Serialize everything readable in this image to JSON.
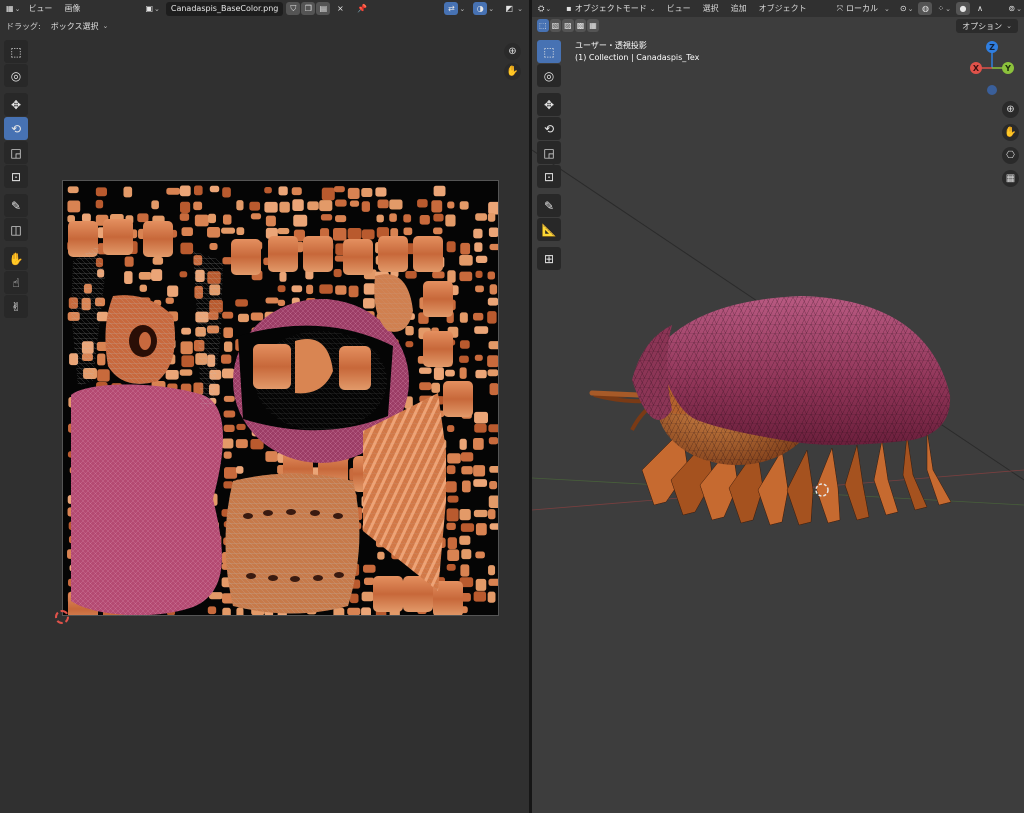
{
  "left_editor": {
    "header": {
      "editor_icon": "image-editor-icon",
      "menus": [
        "ビュー",
        "画像"
      ],
      "image_name": "Canadaspis_BaseColor.png",
      "close_glyph": "×"
    },
    "tool_settings": {
      "drag_label": "ドラッグ:",
      "drag_mode": "ボックス選択"
    },
    "tools": [
      "select-box-tool",
      "cursor-tool",
      "move-tool",
      "rotate-tool",
      "scale-tool",
      "transform-tool",
      "annotate-tool",
      "uv-sculpt-tool",
      "grab-tool",
      "relax-tool",
      "pinch-tool"
    ]
  },
  "right_viewport": {
    "header": {
      "mode": "オブジェクトモード",
      "menus": [
        "ビュー",
        "選択",
        "追加",
        "オブジェクト"
      ],
      "orientation": "ローカル",
      "options_label": "オプション"
    },
    "overlay": {
      "view_name": "ユーザー・透視投影",
      "collection_info": "(1) Collection | Canadaspis_Tex"
    },
    "gizmo_axes": [
      "X",
      "Y",
      "Z"
    ],
    "tools": [
      "select-box-tool",
      "cursor-tool",
      "move-tool",
      "rotate-tool",
      "scale-tool",
      "transform-tool",
      "annotate-tool",
      "measure-tool",
      "add-cube-tool"
    ]
  },
  "colors": {
    "accent_blue": "#4772b3",
    "shell_pink": "#b4456e",
    "body_orange": "#c8713e",
    "axis_x": "#e0524a",
    "axis_y": "#8cc23c",
    "axis_z": "#2f7ee0"
  }
}
